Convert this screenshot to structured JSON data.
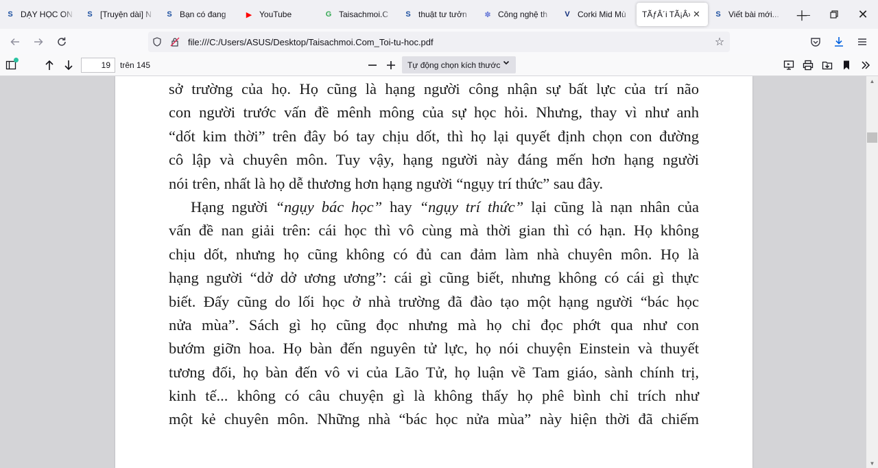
{
  "tabs": [
    {
      "title": "DẠY HỌC ON",
      "icon": "S",
      "color": "#1c4fa0"
    },
    {
      "title": "[Truyện dài] N",
      "icon": "S",
      "color": "#1c4fa0"
    },
    {
      "title": "Bạn có đang",
      "icon": "S",
      "color": "#1c4fa0"
    },
    {
      "title": "YouTube",
      "icon": "▶",
      "color": "#ff0000"
    },
    {
      "title": "Taisachmoi.C",
      "icon": "G",
      "color": "#34a853"
    },
    {
      "title": "thuật tư tưởn",
      "icon": "S",
      "color": "#1c4fa0"
    },
    {
      "title": "Công nghệ th",
      "icon": "✽",
      "color": "#6a7bd8"
    },
    {
      "title": "Corki Mid Mù",
      "icon": "V",
      "color": "#0d2b7a"
    },
    {
      "title": "TÃƒÂ´i TÃ¡Â»Â±",
      "icon": "",
      "color": "#000000",
      "active": true
    },
    {
      "title": "Viết bài mới...",
      "icon": "S",
      "color": "#1c4fa0"
    }
  ],
  "nav": {
    "url": "file:///C:/Users/ASUS/Desktop/Taisachmoi.Com_Toi-tu-hoc.pdf"
  },
  "pdf_toolbar": {
    "page_number": "19",
    "page_total": "trên 145",
    "zoom_label": "Tự động chọn kích thước"
  },
  "content": {
    "lines": [
      {
        "text": "sở trường của họ. Họ cũng là hạng người công nhận sự bất lực của trí não"
      },
      {
        "text": "con người trước vấn đề mênh mông của sự học hỏi. Nhưng, thay vì như anh"
      },
      {
        "text": "“dốt kim thời” trên đây bó tay chịu dốt, thì họ lại quyết định chọn con đường"
      },
      {
        "text": "cô lập và chuyên môn. Tuy vậy, hạng người này đáng mến hơn hạng người"
      },
      {
        "text": "nói trên, nhất là họ dễ thương hơn hạng người “ngụy trí thức” sau đây.",
        "last": true
      },
      {
        "pre": "Hạng người ",
        "em1": "“ngụy bác học”",
        "mid": " hay ",
        "em2": "“ngụy trí thức”",
        "post": " lại cũng là nạn nhân của",
        "indent": true
      },
      {
        "text": "vấn đề nan giải trên: cái học thì vô cùng mà thời gian thì có hạn. Họ không"
      },
      {
        "text": "chịu dốt, nhưng họ cũng không có đủ can đảm làm nhà chuyên môn. Họ là"
      },
      {
        "text": "hạng người “dở dở ương ương”: cái gì cũng biết, nhưng không có cái gì thực"
      },
      {
        "text": "biết. Đấy cũng do lối học ở nhà trường đã đào tạo một hạng người “bác học"
      },
      {
        "text": "nửa mùa”. Sách gì họ cũng đọc nhưng mà họ chỉ đọc phớt qua như con"
      },
      {
        "text": "bướm giỡn hoa. Họ bàn đến nguyên tử lực, họ nói chuyện Einstein và thuyết"
      },
      {
        "text": "tương đối, họ bàn đến vô vi của Lão Tử, họ luận về Tam giáo, sành chính trị,"
      },
      {
        "text": "kinh tế... không có câu chuyện gì là không thấy họ phê bình chỉ trích như"
      },
      {
        "text": "một kẻ chuyên môn. Những nhà “bác học nửa mùa” này hiện thời đã chiếm"
      }
    ]
  }
}
